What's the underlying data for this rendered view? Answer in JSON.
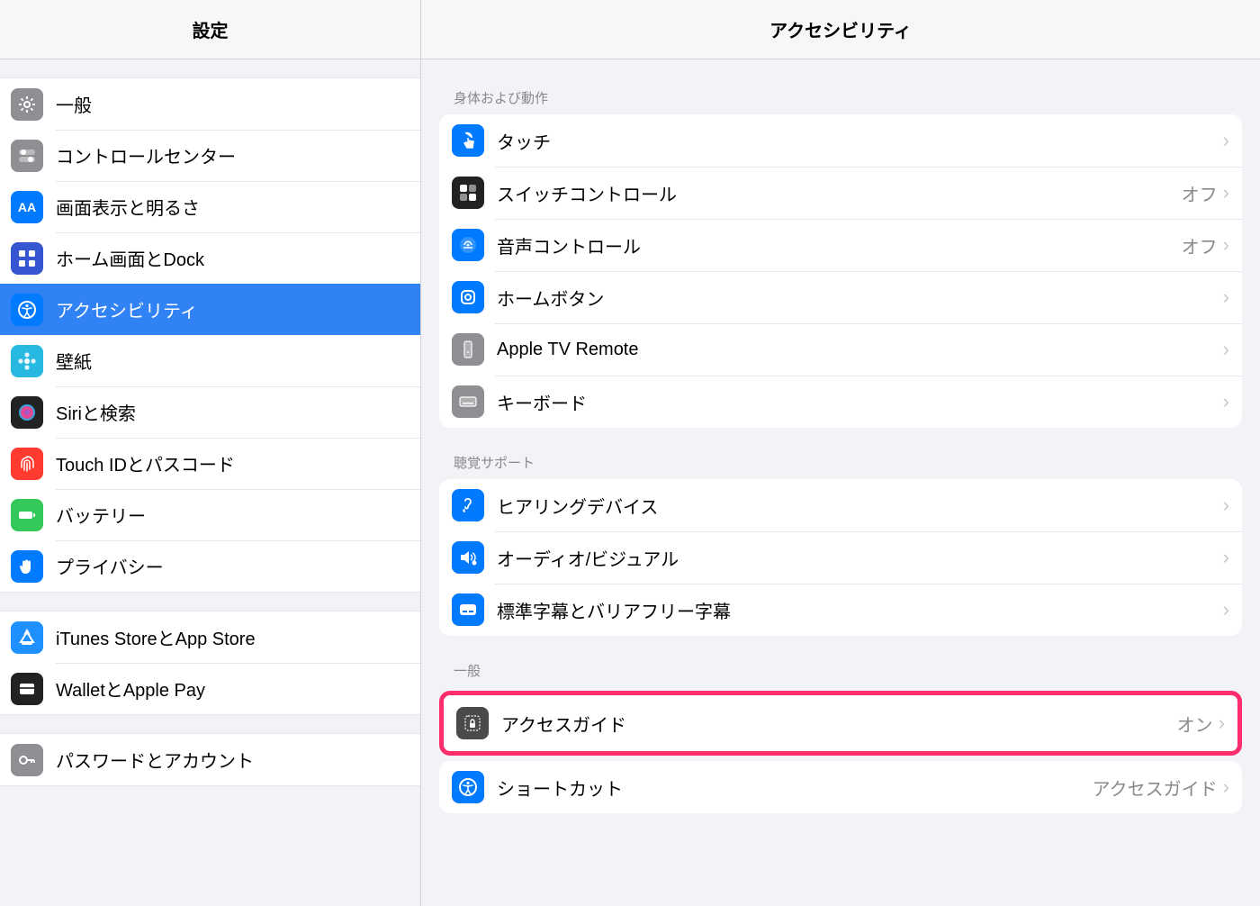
{
  "sidebar": {
    "title": "設定",
    "groups": [
      {
        "items": [
          {
            "id": "general",
            "label": "一般",
            "icon": "gear",
            "bg": "#8e8e93"
          },
          {
            "id": "control",
            "label": "コントロールセンター",
            "icon": "toggles",
            "bg": "#8e8e93"
          },
          {
            "id": "display",
            "label": "画面表示と明るさ",
            "icon": "aa",
            "bg": "#007aff"
          },
          {
            "id": "home",
            "label": "ホーム画面とDock",
            "icon": "grid",
            "bg": "#3555d1"
          },
          {
            "id": "accessibility",
            "label": "アクセシビリティ",
            "icon": "access",
            "bg": "#007aff",
            "selected": true
          },
          {
            "id": "wallpaper",
            "label": "壁紙",
            "icon": "flower",
            "bg": "#28b9e0"
          },
          {
            "id": "siri",
            "label": "Siriと検索",
            "icon": "siri",
            "bg": "#222"
          },
          {
            "id": "touchid",
            "label": "Touch IDとパスコード",
            "icon": "finger",
            "bg": "#ff3b30"
          },
          {
            "id": "battery",
            "label": "バッテリー",
            "icon": "battery",
            "bg": "#34c759"
          },
          {
            "id": "privacy",
            "label": "プライバシー",
            "icon": "hand",
            "bg": "#007aff"
          }
        ]
      },
      {
        "items": [
          {
            "id": "appstore",
            "label": "iTunes StoreとApp Store",
            "icon": "astore",
            "bg": "#1e90ff"
          },
          {
            "id": "wallet",
            "label": "WalletとApple Pay",
            "icon": "wallet",
            "bg": "#222"
          }
        ]
      },
      {
        "items": [
          {
            "id": "passwords",
            "label": "パスワードとアカウント",
            "icon": "key",
            "bg": "#8e8e93"
          }
        ]
      }
    ]
  },
  "detail": {
    "title": "アクセシビリティ",
    "sections": [
      {
        "header": "身体および動作",
        "rows": [
          {
            "id": "touch",
            "label": "タッチ",
            "icon": "touch",
            "bg": "#007aff"
          },
          {
            "id": "switch",
            "label": "スイッチコントロール",
            "icon": "switch",
            "bg": "#222",
            "value": "オフ"
          },
          {
            "id": "voice",
            "label": "音声コントロール",
            "icon": "voice",
            "bg": "#007aff",
            "value": "オフ"
          },
          {
            "id": "homebtn",
            "label": "ホームボタン",
            "icon": "homeb",
            "bg": "#007aff"
          },
          {
            "id": "appletv",
            "label": "Apple TV Remote",
            "icon": "remote",
            "bg": "#8e8e93"
          },
          {
            "id": "keyboard",
            "label": "キーボード",
            "icon": "kbd",
            "bg": "#8e8e93"
          }
        ]
      },
      {
        "header": "聴覚サポート",
        "rows": [
          {
            "id": "hearing",
            "label": "ヒアリングデバイス",
            "icon": "ear",
            "bg": "#007aff"
          },
          {
            "id": "audiov",
            "label": "オーディオ/ビジュアル",
            "icon": "audio",
            "bg": "#007aff"
          },
          {
            "id": "captions",
            "label": "標準字幕とバリアフリー字幕",
            "icon": "cc",
            "bg": "#007aff"
          }
        ]
      },
      {
        "header": "一般",
        "rows": [
          {
            "id": "guided",
            "label": "アクセスガイド",
            "icon": "lockbox",
            "bg": "#4a4a4a",
            "value": "オン",
            "highlight": true
          },
          {
            "id": "shortcut",
            "label": "ショートカット",
            "icon": "access",
            "bg": "#007aff",
            "value": "アクセスガイド"
          }
        ]
      }
    ]
  }
}
